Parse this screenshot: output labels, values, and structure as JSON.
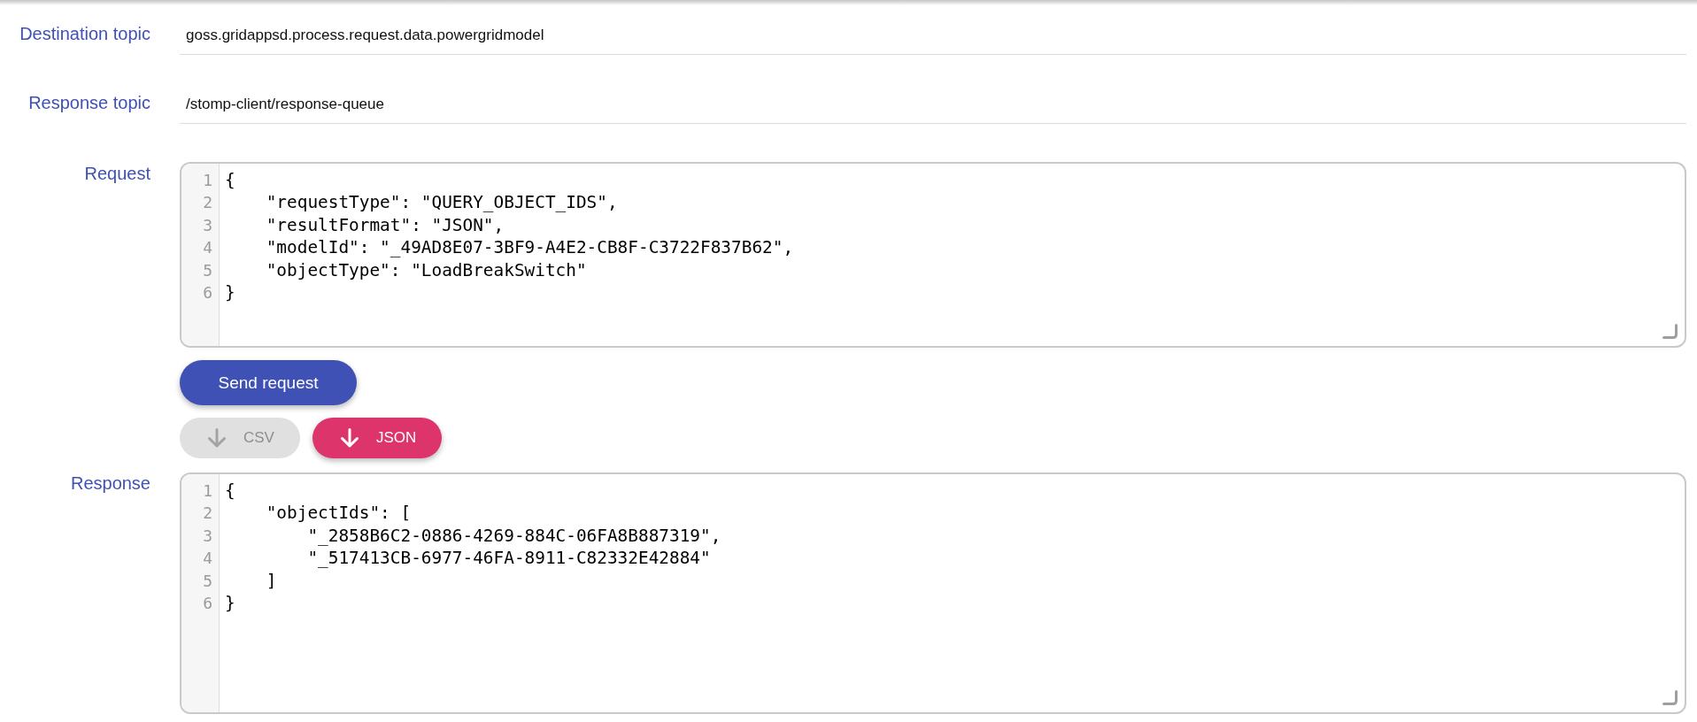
{
  "fields": [
    {
      "label": "Destination topic",
      "value": "goss.gridappsd.process.request.data.powergridmodel"
    },
    {
      "label": "Response topic",
      "value": "/stomp-client/response-queue"
    }
  ],
  "request": {
    "label": "Request",
    "lines": [
      {
        "number": "1",
        "text": "{"
      },
      {
        "number": "2",
        "text": "    \"requestType\": \"QUERY_OBJECT_IDS\","
      },
      {
        "number": "3",
        "text": "    \"resultFormat\": \"JSON\","
      },
      {
        "number": "4",
        "text": "    \"modelId\": \"_49AD8E07-3BF9-A4E2-CB8F-C3722F837B62\","
      },
      {
        "number": "5",
        "text": "    \"objectType\": \"LoadBreakSwitch\""
      },
      {
        "number": "6",
        "text": "}"
      }
    ]
  },
  "send_button": {
    "label": "Send request"
  },
  "download_buttons": [
    {
      "label": "CSV",
      "disabled": true
    },
    {
      "label": "JSON",
      "disabled": false
    }
  ],
  "response": {
    "label": "Response",
    "lines": [
      {
        "number": "1",
        "text": "{"
      },
      {
        "number": "2",
        "text": "    \"objectIds\": ["
      },
      {
        "number": "3",
        "text": "        \"_2858B6C2-0886-4269-884C-06FA8B887319\","
      },
      {
        "number": "4",
        "text": "        \"_517413CB-6977-46FA-8911-C82332E42884\""
      },
      {
        "number": "5",
        "text": "    ]"
      },
      {
        "number": "6",
        "text": "}"
      }
    ]
  }
}
